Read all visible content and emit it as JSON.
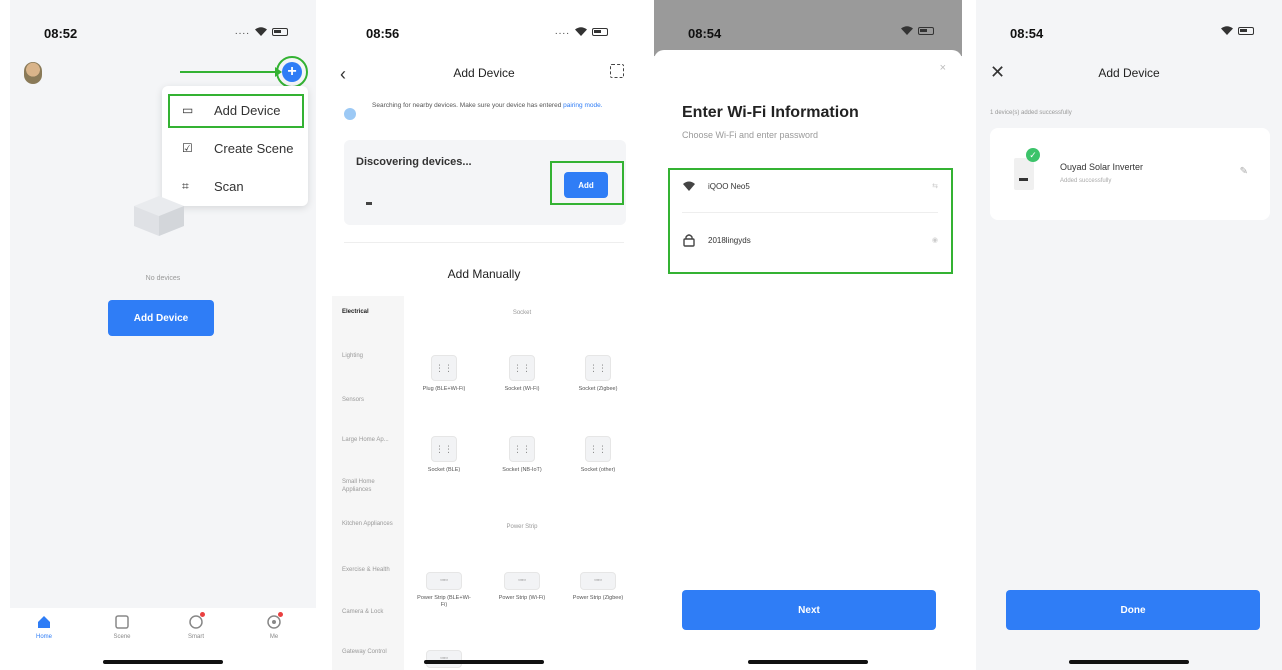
{
  "screen1": {
    "time": "08:52",
    "plus_label": "+",
    "menu": {
      "items": [
        {
          "label": "Add Device",
          "icon": "device-icon"
        },
        {
          "label": "Create Scene",
          "icon": "scene-icon"
        },
        {
          "label": "Scan",
          "icon": "scan-icon"
        }
      ]
    },
    "empty_text": "No devices",
    "add_button": "Add Device",
    "tabs": [
      {
        "label": "Home",
        "icon": "home-icon"
      },
      {
        "label": "Scene",
        "icon": "scene-icon"
      },
      {
        "label": "Smart",
        "icon": "smart-icon"
      },
      {
        "label": "Me",
        "icon": "me-icon"
      }
    ]
  },
  "screen2": {
    "time": "08:56",
    "title": "Add Device",
    "hint_text": "Searching for nearby devices. Make sure your device has entered",
    "hint_link": "pairing mode.",
    "discovering": "Discovering devices...",
    "add_button": "Add",
    "manual_title": "Add Manually",
    "categories": [
      "Electrical",
      "Lighting",
      "Sensors",
      "Large Home Ap...",
      "Small Home Appliances",
      "Kitchen Appliances",
      "Exercise & Health",
      "Camera & Lock",
      "Gateway Control"
    ],
    "section_socket": "Socket",
    "section_power_strip": "Power Strip",
    "socket_devices": [
      "Plug (BLE+Wi-Fi)",
      "Socket (Wi-Fi)",
      "Socket (Zigbee)",
      "Socket (BLE)",
      "Socket (NB-IoT)",
      "Socket (other)"
    ],
    "strip_devices": [
      "Power Strip (BLE+Wi-Fi)",
      "Power Strip (Wi-Fi)",
      "Power Strip (Zigbee)"
    ]
  },
  "screen3": {
    "time": "08:54",
    "close": "×",
    "heading": "Enter Wi-Fi Information",
    "subheading": "Choose Wi-Fi and enter password",
    "wifi_name": "iQOO Neo5",
    "password": "2018lingyds",
    "next_button": "Next"
  },
  "screen4": {
    "time": "08:54",
    "title": "Add Device",
    "note": "1 device(s) added successfully",
    "device_name": "Ouyad Solar Inverter",
    "device_status": "Added successfully",
    "done_button": "Done"
  },
  "colors": {
    "accent": "#2f7df6",
    "highlight": "#34b233",
    "success": "#3cc36a"
  }
}
